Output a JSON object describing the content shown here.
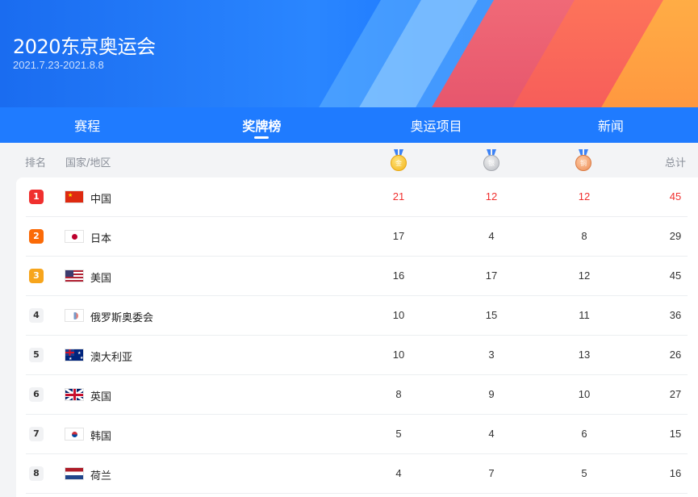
{
  "header": {
    "title": "2020东京奥运会",
    "dates": "2021.7.23-2021.8.8"
  },
  "tabs": [
    {
      "label": "赛程",
      "active": false
    },
    {
      "label": "奖牌榜",
      "active": true
    },
    {
      "label": "奥运项目",
      "active": false
    },
    {
      "label": "新闻",
      "active": false
    }
  ],
  "columns": {
    "rank": "排名",
    "country": "国家/地区",
    "gold_icon": "gold-medal-icon",
    "silver_icon": "silver-medal-icon",
    "bronze_icon": "bronze-medal-icon",
    "gold_glyph": "金",
    "silver_glyph": "银",
    "bronze_glyph": "铜",
    "total": "总计"
  },
  "rows": [
    {
      "rank": "1",
      "country": "中国",
      "flag": "flag-china-icon",
      "gold": "21",
      "silver": "12",
      "bronze": "12",
      "total": "45",
      "highlight": true
    },
    {
      "rank": "2",
      "country": "日本",
      "flag": "flag-japan-icon",
      "gold": "17",
      "silver": "4",
      "bronze": "8",
      "total": "29",
      "highlight": false
    },
    {
      "rank": "3",
      "country": "美国",
      "flag": "flag-usa-icon",
      "gold": "16",
      "silver": "17",
      "bronze": "12",
      "total": "45",
      "highlight": false
    },
    {
      "rank": "4",
      "country": "俄罗斯奥委会",
      "flag": "flag-roc-icon",
      "gold": "10",
      "silver": "15",
      "bronze": "11",
      "total": "36",
      "highlight": false
    },
    {
      "rank": "5",
      "country": "澳大利亚",
      "flag": "flag-australia-icon",
      "gold": "10",
      "silver": "3",
      "bronze": "13",
      "total": "26",
      "highlight": false
    },
    {
      "rank": "6",
      "country": "英国",
      "flag": "flag-uk-icon",
      "gold": "8",
      "silver": "9",
      "bronze": "10",
      "total": "27",
      "highlight": false
    },
    {
      "rank": "7",
      "country": "韩国",
      "flag": "flag-korea-icon",
      "gold": "5",
      "silver": "4",
      "bronze": "6",
      "total": "15",
      "highlight": false
    },
    {
      "rank": "8",
      "country": "荷兰",
      "flag": "flag-netherlands-icon",
      "gold": "4",
      "silver": "7",
      "bronze": "5",
      "total": "16",
      "highlight": false
    }
  ],
  "colors": {
    "brand_blue": "#1f7bff",
    "highlight_red": "#f0302f",
    "rank1": "#f0302f",
    "rank2": "#fb6a07",
    "rank3": "#f7a51c"
  }
}
